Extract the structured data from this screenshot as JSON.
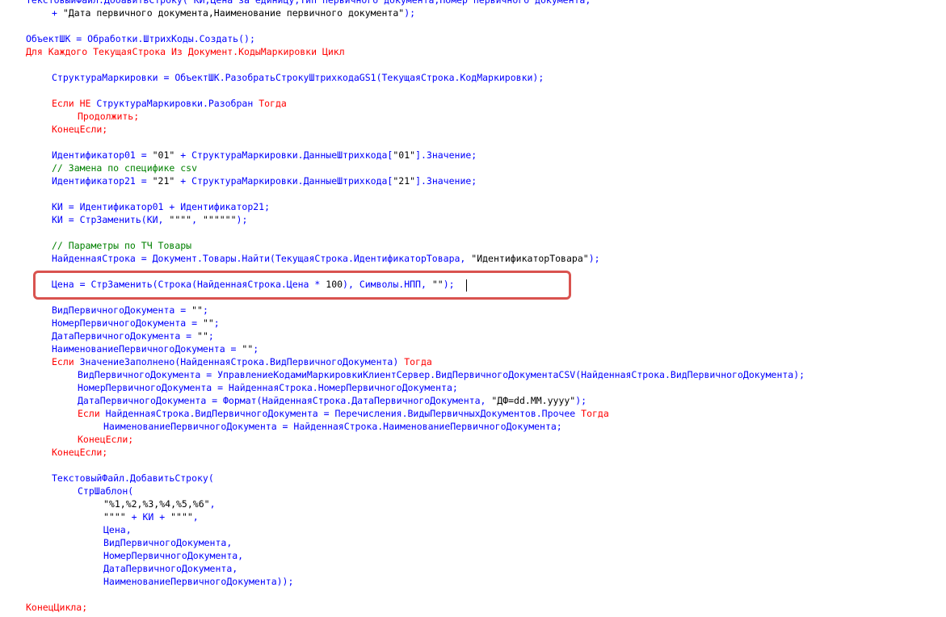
{
  "editor": {
    "lines": [
      {
        "indent": 1,
        "segments": [
          {
            "t": "ТекстовыйФайл.ДобавитьСтроку(\"КИ,Цена за единицу,Тип первичного документа,Номер первичного документа,\"",
            "c": "tx"
          }
        ]
      },
      {
        "indent": 2,
        "segments": [
          {
            "t": "+ ",
            "c": "tx"
          },
          {
            "t": "\"Дата первичного документа,Наименование первичного документа\"",
            "c": "st"
          },
          {
            "t": ");",
            "c": "tx"
          }
        ]
      },
      {
        "indent": 0,
        "segments": []
      },
      {
        "indent": 1,
        "segments": [
          {
            "t": "ОбъектШК = Обработки.ШтрихКоды.Создать();",
            "c": "tx"
          }
        ]
      },
      {
        "indent": 1,
        "segments": [
          {
            "t": "Для Каждого ТекущаяСтрока Из Документ.КодыМаркировки Цикл",
            "c": "kw"
          }
        ]
      },
      {
        "indent": 0,
        "segments": []
      },
      {
        "indent": 2,
        "segments": [
          {
            "t": "СтруктураМаркировки = ОбъектШК.РазобратьСтрокуШтрихкодаGS1(ТекущаяСтрока.КодМаркировки);",
            "c": "tx"
          }
        ]
      },
      {
        "indent": 0,
        "segments": []
      },
      {
        "indent": 2,
        "segments": [
          {
            "t": "Если НЕ ",
            "c": "kw"
          },
          {
            "t": "СтруктураМаркировки.Разобран ",
            "c": "tx"
          },
          {
            "t": "Тогда",
            "c": "kw"
          }
        ]
      },
      {
        "indent": 3,
        "segments": [
          {
            "t": "Продолжить;",
            "c": "kw"
          }
        ]
      },
      {
        "indent": 2,
        "segments": [
          {
            "t": "КонецЕсли;",
            "c": "kw"
          }
        ]
      },
      {
        "indent": 0,
        "segments": []
      },
      {
        "indent": 2,
        "segments": [
          {
            "t": "Идентификатор01 = ",
            "c": "tx"
          },
          {
            "t": "\"01\"",
            "c": "st"
          },
          {
            "t": " + СтруктураМаркировки.ДанныеШтрихкода[",
            "c": "tx"
          },
          {
            "t": "\"01\"",
            "c": "st"
          },
          {
            "t": "].Значение;",
            "c": "tx"
          }
        ]
      },
      {
        "indent": 2,
        "segments": [
          {
            "t": "// Замена по специфике csv",
            "c": "cm"
          }
        ]
      },
      {
        "indent": 2,
        "segments": [
          {
            "t": "Идентификатор21 = ",
            "c": "tx"
          },
          {
            "t": "\"21\"",
            "c": "st"
          },
          {
            "t": " + СтруктураМаркировки.ДанныеШтрихкода[",
            "c": "tx"
          },
          {
            "t": "\"21\"",
            "c": "st"
          },
          {
            "t": "].Значение;",
            "c": "tx"
          }
        ]
      },
      {
        "indent": 0,
        "segments": []
      },
      {
        "indent": 2,
        "segments": [
          {
            "t": "КИ = Идентификатор01 + Идентификатор21;",
            "c": "tx"
          }
        ]
      },
      {
        "indent": 2,
        "segments": [
          {
            "t": "КИ = СтрЗаменить(КИ, ",
            "c": "tx"
          },
          {
            "t": "\"\"\"\"",
            "c": "st"
          },
          {
            "t": ", ",
            "c": "tx"
          },
          {
            "t": "\"\"\"\"\"\"",
            "c": "st"
          },
          {
            "t": ");",
            "c": "tx"
          }
        ]
      },
      {
        "indent": 0,
        "segments": []
      },
      {
        "indent": 2,
        "segments": [
          {
            "t": "// Параметры по ТЧ Товары",
            "c": "cm"
          }
        ]
      },
      {
        "indent": 2,
        "segments": [
          {
            "t": "НайденнаяСтрока = Документ.Товары.Найти(ТекущаяСтрока.ИдентификаторТовара, ",
            "c": "tx"
          },
          {
            "t": "\"ИдентификаторТовара\"",
            "c": "st"
          },
          {
            "t": ");",
            "c": "tx"
          }
        ]
      },
      {
        "indent": 0,
        "segments": []
      },
      {
        "indent": 2,
        "segments": [
          {
            "t": "Цена = СтрЗаменить(Строка(НайденнаяСтрока.Цена * ",
            "c": "tx"
          },
          {
            "t": "100",
            "c": "st"
          },
          {
            "t": "), Символы.НПП, ",
            "c": "tx"
          },
          {
            "t": "\"\"",
            "c": "st"
          },
          {
            "t": ");",
            "c": "tx"
          }
        ]
      },
      {
        "indent": 0,
        "segments": []
      },
      {
        "indent": 2,
        "segments": [
          {
            "t": "ВидПервичногоДокумента = ",
            "c": "tx"
          },
          {
            "t": "\"\"",
            "c": "st"
          },
          {
            "t": ";",
            "c": "tx"
          }
        ]
      },
      {
        "indent": 2,
        "segments": [
          {
            "t": "НомерПервичногоДокумента = ",
            "c": "tx"
          },
          {
            "t": "\"\"",
            "c": "st"
          },
          {
            "t": ";",
            "c": "tx"
          }
        ]
      },
      {
        "indent": 2,
        "segments": [
          {
            "t": "ДатаПервичногоДокумента = ",
            "c": "tx"
          },
          {
            "t": "\"\"",
            "c": "st"
          },
          {
            "t": ";",
            "c": "tx"
          }
        ]
      },
      {
        "indent": 2,
        "segments": [
          {
            "t": "НаименованиеПервичногоДокумента = ",
            "c": "tx"
          },
          {
            "t": "\"\"",
            "c": "st"
          },
          {
            "t": ";",
            "c": "tx"
          }
        ]
      },
      {
        "indent": 2,
        "segments": [
          {
            "t": "Если ",
            "c": "kw"
          },
          {
            "t": "ЗначениеЗаполнено(НайденнаяСтрока.ВидПервичногоДокумента) ",
            "c": "tx"
          },
          {
            "t": "Тогда",
            "c": "kw"
          }
        ]
      },
      {
        "indent": 3,
        "segments": [
          {
            "t": "ВидПервичногоДокумента = УправлениеКодамиМаркировкиКлиентСервер.ВидПервичногоДокументаCSV(НайденнаяСтрока.ВидПервичногоДокумента);",
            "c": "tx"
          }
        ]
      },
      {
        "indent": 3,
        "segments": [
          {
            "t": "НомерПервичногоДокумента = НайденнаяСтрока.НомерПервичногоДокумента;",
            "c": "tx"
          }
        ]
      },
      {
        "indent": 3,
        "segments": [
          {
            "t": "ДатаПервичногоДокумента = Формат(НайденнаяСтрока.ДатаПервичногоДокумента, ",
            "c": "tx"
          },
          {
            "t": "\"ДФ=dd.MM.yyyy\"",
            "c": "st"
          },
          {
            "t": ");",
            "c": "tx"
          }
        ]
      },
      {
        "indent": 3,
        "segments": [
          {
            "t": "Если ",
            "c": "kw"
          },
          {
            "t": "НайденнаяСтрока.ВидПервичногоДокумента = Перечисления.ВидыПервичныхДокументов.Прочее ",
            "c": "tx"
          },
          {
            "t": "Тогда",
            "c": "kw"
          }
        ]
      },
      {
        "indent": 4,
        "segments": [
          {
            "t": "НаименованиеПервичногоДокумента = НайденнаяСтрока.НаименованиеПервичногоДокумента;",
            "c": "tx"
          }
        ]
      },
      {
        "indent": 3,
        "segments": [
          {
            "t": "КонецЕсли;",
            "c": "kw"
          }
        ]
      },
      {
        "indent": 2,
        "segments": [
          {
            "t": "КонецЕсли;",
            "c": "kw"
          }
        ]
      },
      {
        "indent": 0,
        "segments": []
      },
      {
        "indent": 2,
        "segments": [
          {
            "t": "ТекстовыйФайл.ДобавитьСтроку(",
            "c": "tx"
          }
        ]
      },
      {
        "indent": 3,
        "segments": [
          {
            "t": "СтрШаблон(",
            "c": "tx"
          }
        ]
      },
      {
        "indent": 4,
        "segments": [
          {
            "t": "\"%1,%2,%3,%4,%5,%6\"",
            "c": "st"
          },
          {
            "t": ",",
            "c": "tx"
          }
        ]
      },
      {
        "indent": 4,
        "segments": [
          {
            "t": "\"\"\"\"",
            "c": "st"
          },
          {
            "t": " + КИ + ",
            "c": "tx"
          },
          {
            "t": "\"\"\"\"",
            "c": "st"
          },
          {
            "t": ",",
            "c": "tx"
          }
        ]
      },
      {
        "indent": 4,
        "segments": [
          {
            "t": "Цена,",
            "c": "tx"
          }
        ]
      },
      {
        "indent": 4,
        "segments": [
          {
            "t": "ВидПервичногоДокумента,",
            "c": "tx"
          }
        ]
      },
      {
        "indent": 4,
        "segments": [
          {
            "t": "НомерПервичногоДокумента,",
            "c": "tx"
          }
        ]
      },
      {
        "indent": 4,
        "segments": [
          {
            "t": "ДатаПервичногоДокумента,",
            "c": "tx"
          }
        ]
      },
      {
        "indent": 4,
        "segments": [
          {
            "t": "НаименованиеПервичногоДокумента));",
            "c": "tx"
          }
        ]
      },
      {
        "indent": 0,
        "segments": []
      },
      {
        "indent": 1,
        "segments": [
          {
            "t": "КонецЦикла;",
            "c": "kw"
          }
        ]
      }
    ]
  },
  "colors": {
    "keyword": "#ff0000",
    "comment": "#008000",
    "string": "#000000",
    "text": "#0000ff",
    "highlight_box": "#d9534f"
  }
}
